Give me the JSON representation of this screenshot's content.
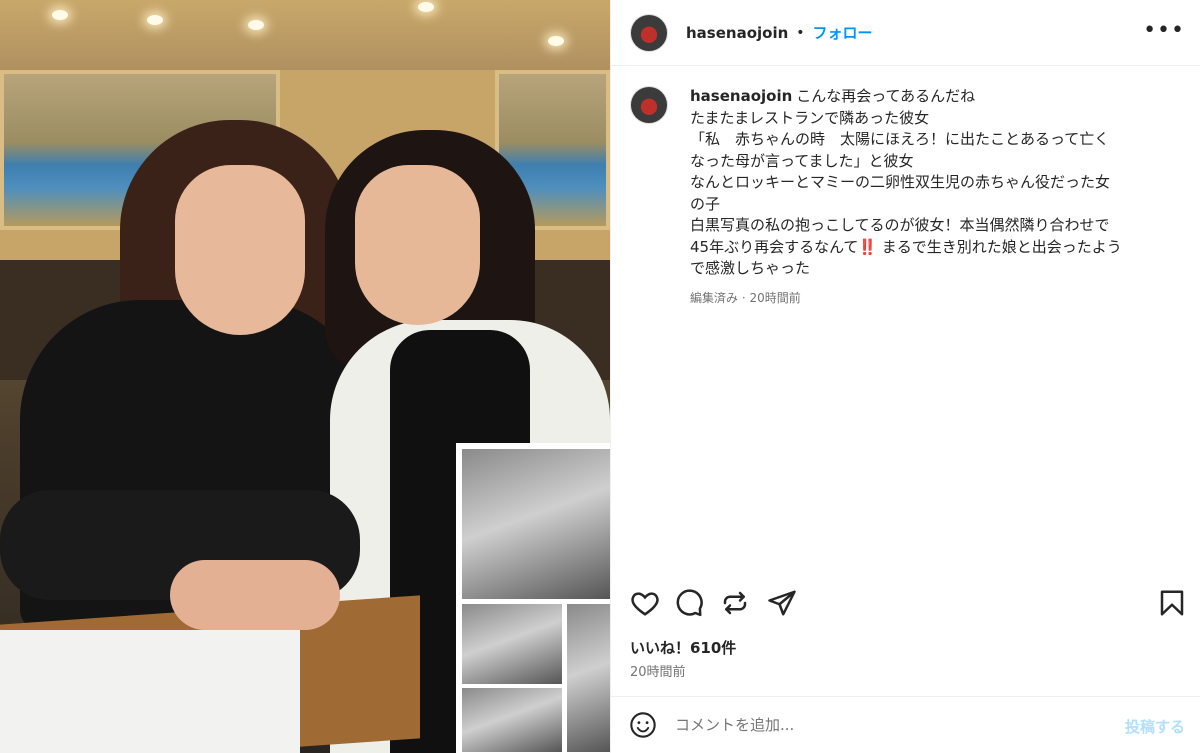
{
  "post": {
    "username": "hasenaojoin",
    "separator": "•",
    "follow_label": "フォロー",
    "more_label": "•••",
    "caption_user": "hasenaojoin",
    "caption_lines": [
      "こんな再会ってあるんだね",
      "たまたまレストランで隣あった彼女",
      "「私　赤ちゃんの時　太陽にほえろ！に出たことあるって亡く",
      "なった母が言ってました」と彼女",
      "なんとロッキーとマミーの二卵性双生児の赤ちゃん役だった女",
      "の子",
      "白黒写真の私の抱っこしてるのが彼女！本当偶然隣り合わせで",
      "45年ぶり再会するなんて‼️ まるで生き別れた娘と出会ったよう",
      "で感激しちゃった"
    ],
    "caption_meta": "編集済み · 20時間前",
    "likes": "いいね！610件",
    "timestamp": "20時間前"
  },
  "comment": {
    "placeholder": "コメントを追加...",
    "post_label": "投稿する"
  },
  "icons": {
    "like": "heart-icon",
    "comment": "comment-icon",
    "repost": "repost-icon",
    "share": "share-icon",
    "save": "bookmark-icon",
    "emoji": "emoji-icon",
    "more": "more-icon"
  },
  "colors": {
    "accent": "#0095f6",
    "muted": "#737373",
    "post_disabled": "#b2dffc"
  }
}
